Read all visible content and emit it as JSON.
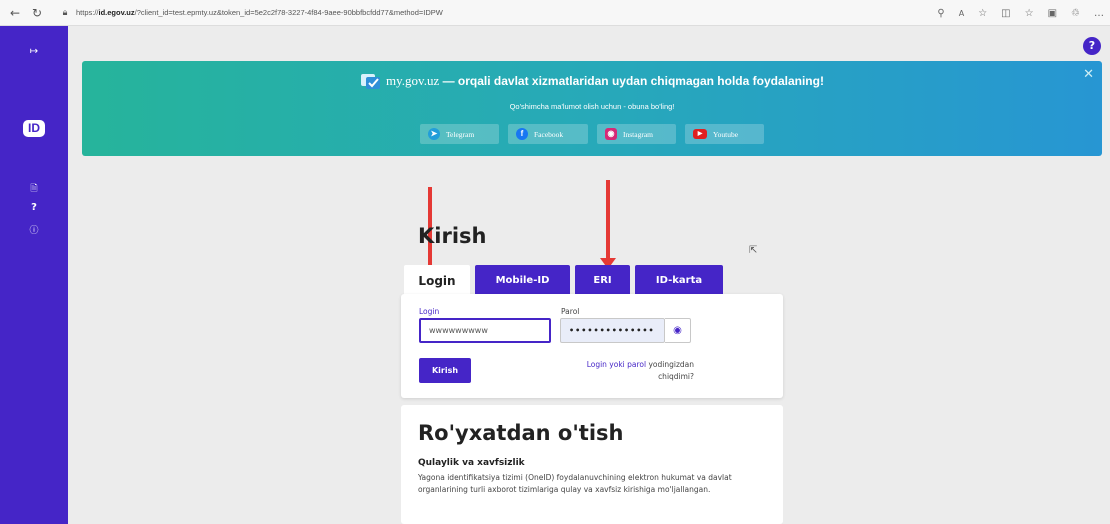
{
  "browser": {
    "url_prefix": "https://",
    "url_domain": "id.egov.uz",
    "url_rest": "/?client_id=test.epmty.uz&token_id=5e2c2f78-3227-4f84-9aee-90bbfbcfdd77&method=IDPW"
  },
  "sidebar": {
    "logo_text": "ID",
    "help_label": "?"
  },
  "banner": {
    "site_name": "my.gov.uz",
    "headline": " — orqali davlat xizmatlaridan uydan chiqmagan holda foydalaning!",
    "subtitle": "Qo'shimcha ma'lumot olish uchun - obuna bo'ling!",
    "socials": [
      {
        "label": "Telegram",
        "icon": "telegram-icon",
        "color": "#229ED9"
      },
      {
        "label": "Facebook",
        "icon": "facebook-icon",
        "color": "#1877F2"
      },
      {
        "label": "Instagram",
        "icon": "instagram-icon",
        "color": "#D62976"
      },
      {
        "label": "Youtube",
        "icon": "youtube-icon",
        "color": "#E02020"
      }
    ]
  },
  "login": {
    "title": "Kirish",
    "tabs": [
      {
        "label": "Login",
        "active": true
      },
      {
        "label": "Mobile-ID",
        "active": false
      },
      {
        "label": "ERI",
        "active": false
      },
      {
        "label": "ID-karta",
        "active": false
      }
    ],
    "login_label": "Login",
    "login_value": "wwwwwwwww",
    "password_label": "Parol",
    "password_value": "••••••••••••••",
    "submit_label": "Kirish",
    "forgot_link": "Login yoki parol",
    "forgot_text": " yodingizdan chiqdimi?"
  },
  "register": {
    "title": "Ro'yxatdan o'tish",
    "subtitle": "Qulaylik va xavfsizlik",
    "text": "Yagona identifikatsiya tizimi (OneID) foydalanuvchining elektron hukumat va davlat organlarining turli axborot tizimlariga qulay va xavfsiz kirishiga mo'ljallangan."
  },
  "colors": {
    "brand": "#4525C7",
    "annotation_arrow": "#E53935"
  }
}
